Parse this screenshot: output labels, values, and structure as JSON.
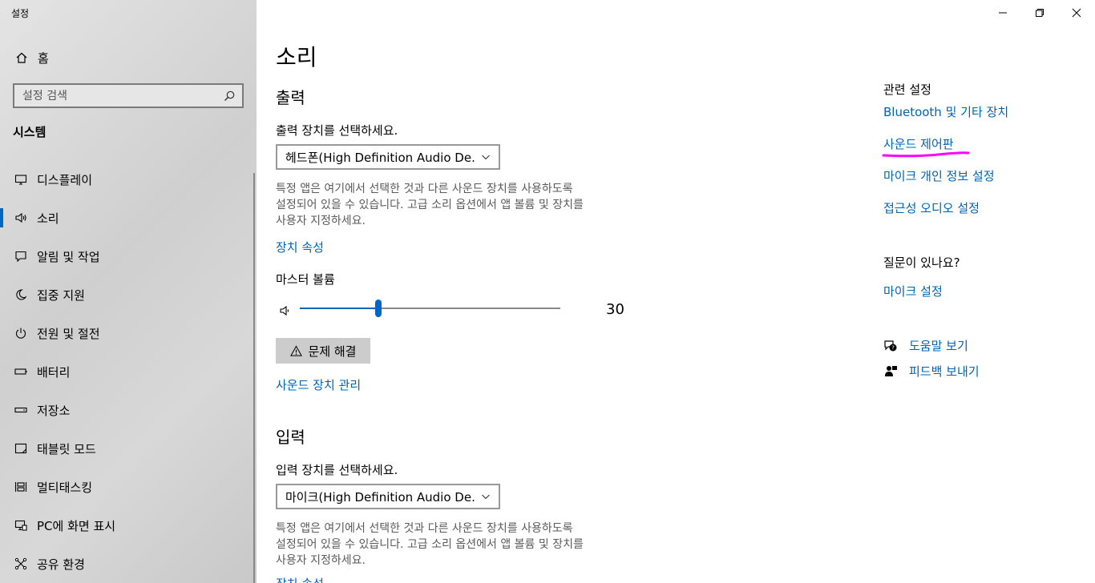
{
  "app": {
    "title": "설정"
  },
  "sidebar": {
    "home_label": "홈",
    "search_placeholder": "설정 검색",
    "section": "시스템",
    "items": [
      {
        "label": "디스플레이",
        "icon": "monitor-icon"
      },
      {
        "label": "소리",
        "icon": "speaker-icon",
        "active": true
      },
      {
        "label": "알림 및 작업",
        "icon": "notification-icon"
      },
      {
        "label": "집중 지원",
        "icon": "moon-icon"
      },
      {
        "label": "전원 및 절전",
        "icon": "power-icon"
      },
      {
        "label": "배터리",
        "icon": "battery-icon"
      },
      {
        "label": "저장소",
        "icon": "storage-icon"
      },
      {
        "label": "태블릿 모드",
        "icon": "tablet-icon"
      },
      {
        "label": "멀티태스킹",
        "icon": "multitasking-icon"
      },
      {
        "label": "PC에 화면 표시",
        "icon": "project-icon"
      },
      {
        "label": "공유 환경",
        "icon": "share-icon"
      }
    ]
  },
  "main": {
    "title": "소리",
    "output": {
      "heading": "출력",
      "select_label": "출력 장치를 선택하세요.",
      "device": "헤드폰(High Definition Audio De...",
      "desc_lines": [
        "특정 앱은 여기에서 선택한 것과 다른 사운드 장치를 사용하도록",
        "설정되어 있을 수 있습니다. 고급 소리 옵션에서 앱 볼륨 및 장치를",
        "사용자 지정하세요."
      ],
      "device_props": "장치 속성",
      "master_volume_label": "마스터 볼륨",
      "volume": 30,
      "troubleshoot": "문제 해결",
      "manage_devices": "사운드 장치 관리"
    },
    "input": {
      "heading": "입력",
      "select_label": "입력 장치를 선택하세요.",
      "device": "마이크(High Definition Audio De...",
      "desc_lines": [
        "특정 앱은 여기에서 선택한 것과 다른 사운드 장치를 사용하도록",
        "설정되어 있을 수 있습니다. 고급 소리 옵션에서 앱 볼륨 및 장치를",
        "사용자 지정하세요."
      ],
      "device_props": "장치 속성"
    }
  },
  "related": {
    "heading": "관련 설정",
    "links": [
      "Bluetooth 및 기타 장치",
      "사운드 제어판",
      "마이크 개인 정보 설정",
      "접근성 오디오 설정"
    ],
    "question_heading": "질문이 있나요?",
    "mic_settings": "마이크 설정",
    "help": "도움말 보기",
    "feedback": "피드백 보내기"
  },
  "colors": {
    "accent": "#0067c0",
    "link": "#0063b1",
    "highlight": "#ff00ff"
  }
}
